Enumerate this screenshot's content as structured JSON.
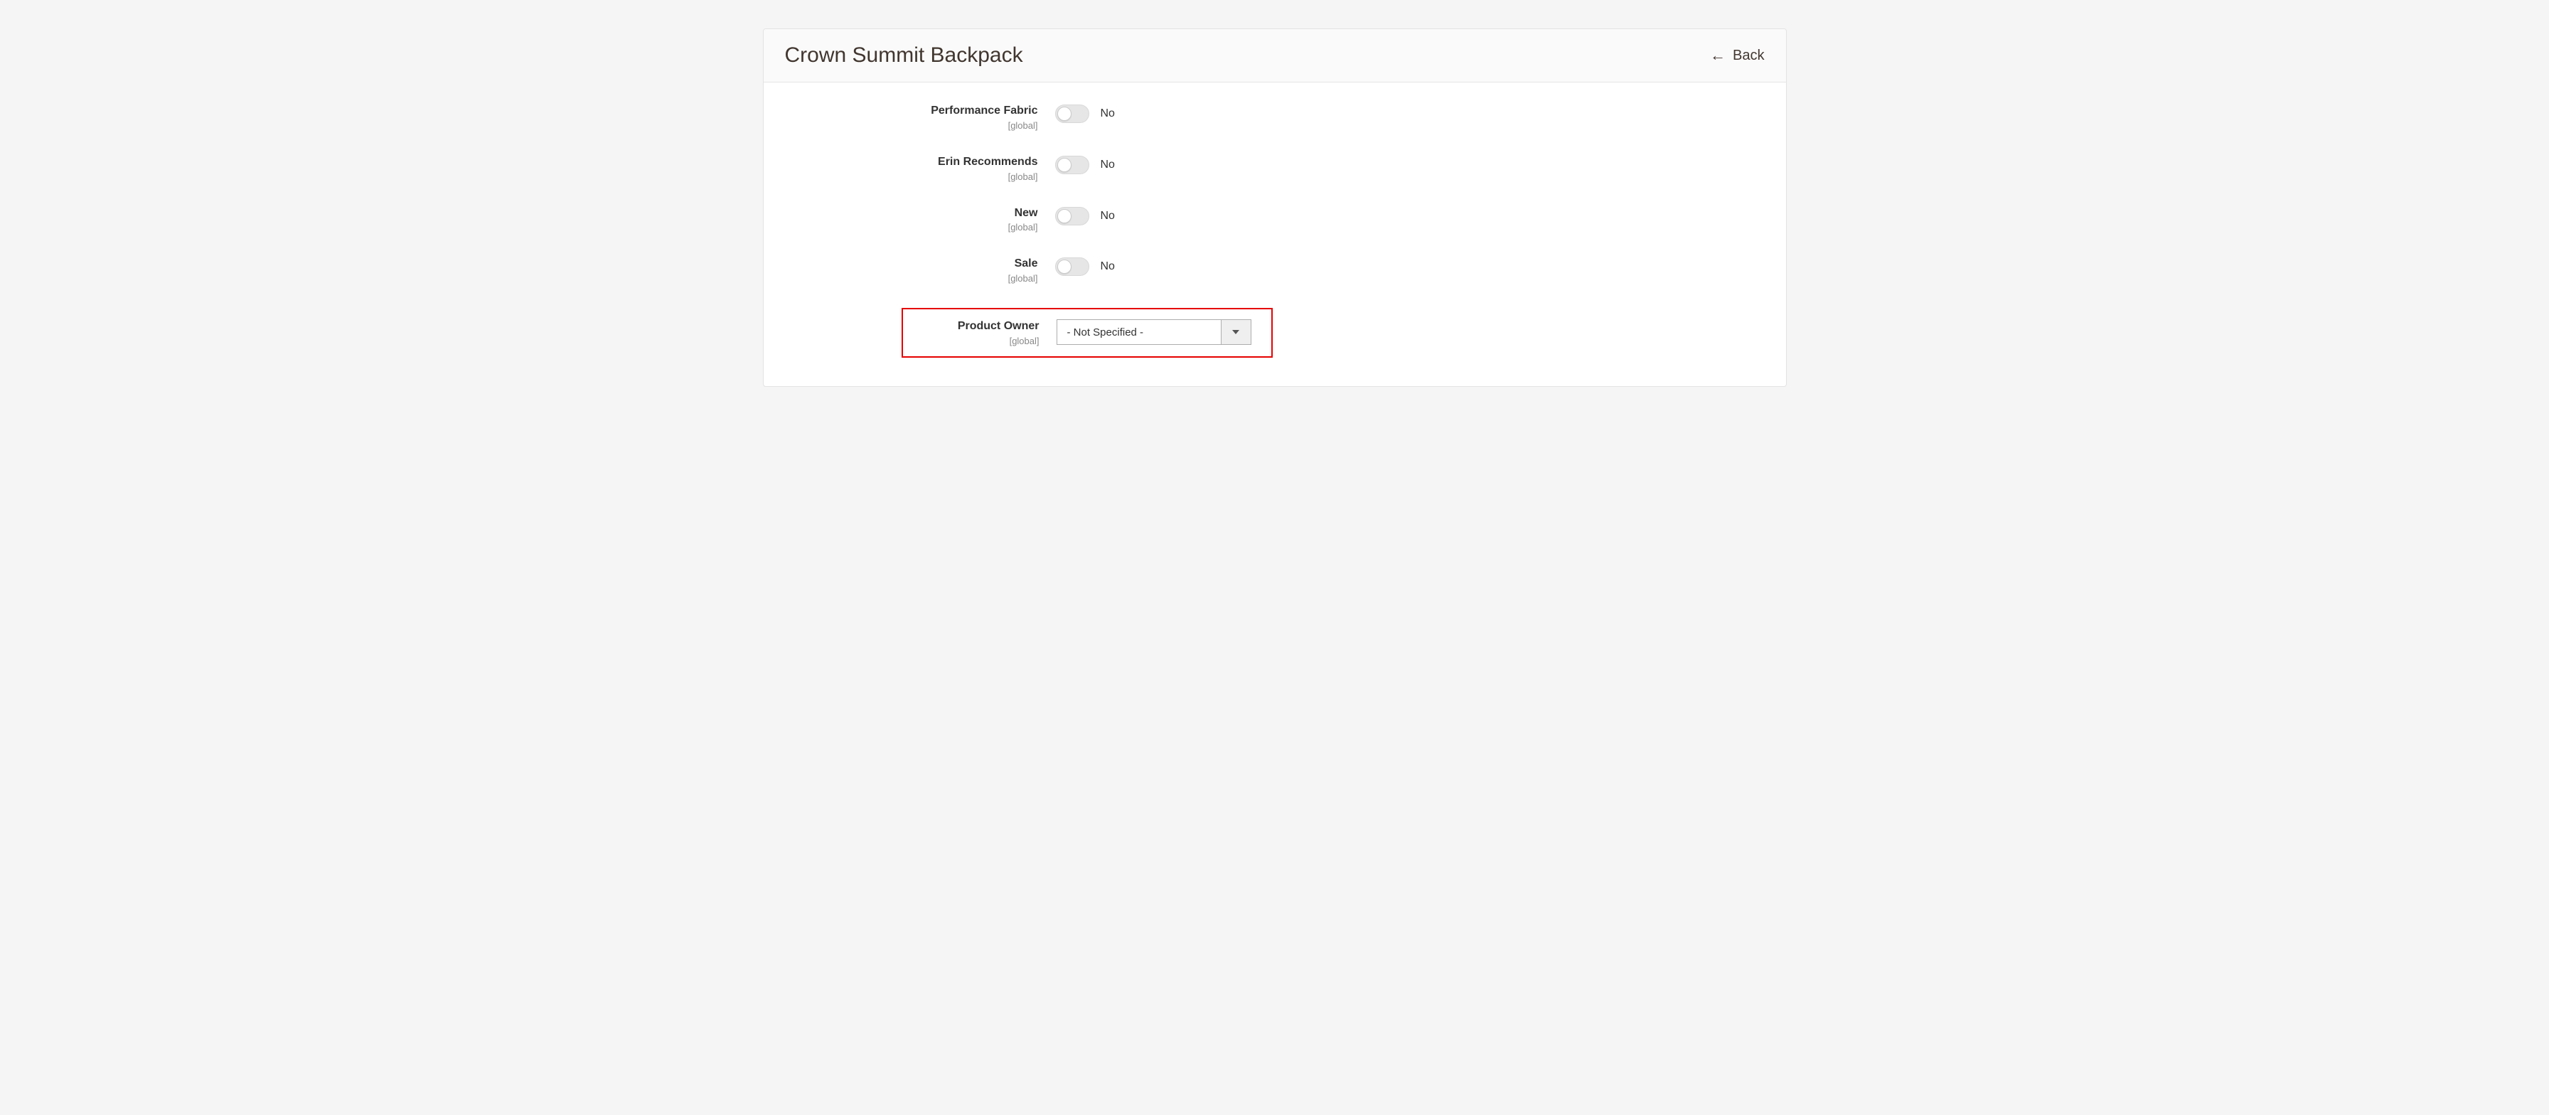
{
  "header": {
    "title": "Crown Summit Backpack",
    "back_label": "Back"
  },
  "scope_label": "[global]",
  "toggles": [
    {
      "label": "Performance Fabric",
      "state": "No"
    },
    {
      "label": "Erin Recommends",
      "state": "No"
    },
    {
      "label": "New",
      "state": "No"
    },
    {
      "label": "Sale",
      "state": "No"
    }
  ],
  "product_owner": {
    "label": "Product Owner",
    "value": "- Not Specified -"
  }
}
